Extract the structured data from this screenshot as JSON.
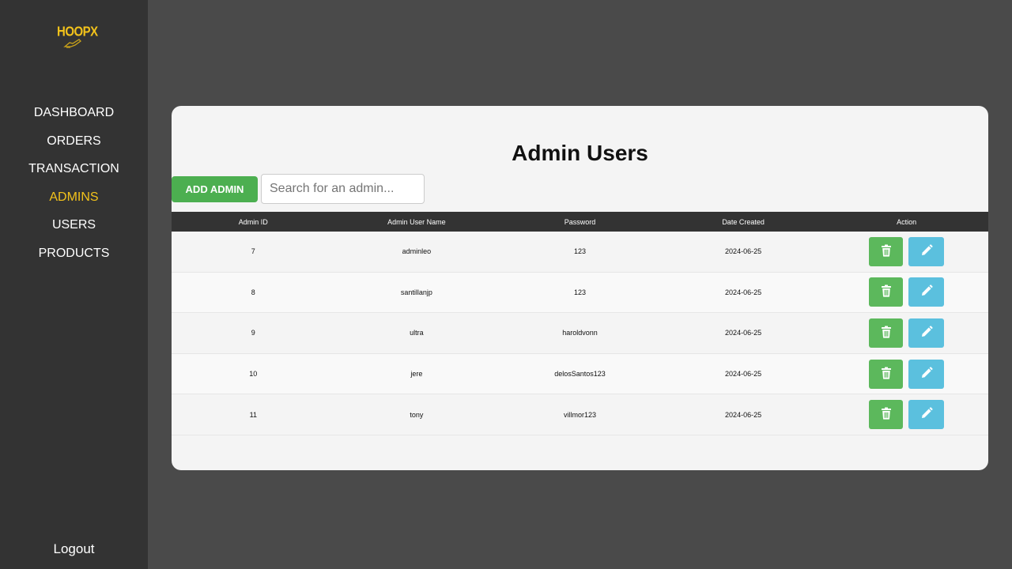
{
  "brand": {
    "logo_text": "HOOPX"
  },
  "sidebar": {
    "items": [
      {
        "label": "DASHBOARD",
        "active": false
      },
      {
        "label": "ORDERS",
        "active": false
      },
      {
        "label": "TRANSACTION",
        "active": false
      },
      {
        "label": "ADMINS",
        "active": true
      },
      {
        "label": "USERS",
        "active": false
      },
      {
        "label": "PRODUCTS",
        "active": false
      }
    ],
    "logout_label": "Logout"
  },
  "main": {
    "title": "Admin Users",
    "add_button_label": "ADD ADMIN",
    "search_placeholder": "Search for an admin...",
    "search_value": ""
  },
  "table": {
    "columns": [
      "Admin ID",
      "Admin User Name",
      "Password",
      "Date Created",
      "Action"
    ],
    "rows": [
      {
        "id": "7",
        "username": "adminleo",
        "password": "123",
        "date": "2024-06-25"
      },
      {
        "id": "8",
        "username": "santillanjp",
        "password": "123",
        "date": "2024-06-25"
      },
      {
        "id": "9",
        "username": "ultra",
        "password": "haroldvonn",
        "date": "2024-06-25"
      },
      {
        "id": "10",
        "username": "jere",
        "password": "delosSantos123",
        "date": "2024-06-25"
      },
      {
        "id": "11",
        "username": "tony",
        "password": "villmor123",
        "date": "2024-06-25"
      }
    ]
  },
  "icons": {
    "delete": "trash-icon",
    "edit": "pencil-icon",
    "logo": "shoe-icon"
  },
  "colors": {
    "accent": "#f2c21b",
    "add_button": "#4caf50",
    "delete_button": "#5cb85c",
    "edit_button": "#5bc0de",
    "sidebar": "#333333",
    "background": "#4a4a4a"
  }
}
